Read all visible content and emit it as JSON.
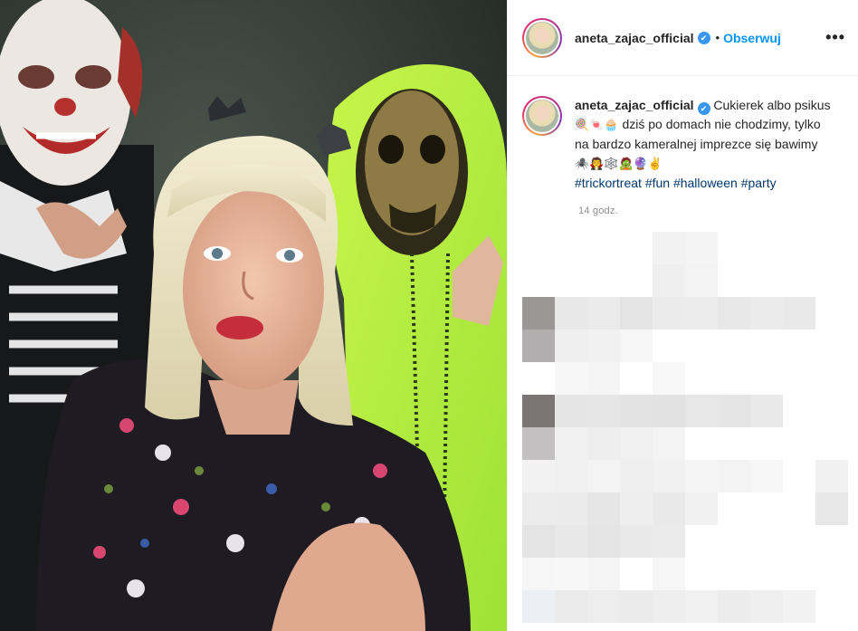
{
  "post": {
    "username": "aneta_zajac_official",
    "verified_badge": "✔",
    "dot": "•",
    "follow_label": "Obserwuj",
    "more_label": "•••",
    "caption": {
      "text_1": "Cukierek albo psikus",
      "emojis_1": "🍭🍬🧁",
      "text_2": "dziś po domach nie chodzimy, tylko na bardzo kameralnej imprezce się bawimy",
      "emojis_2": "🕷️🧛🕸️🧟🔮✌️",
      "hashtags": [
        "#trickortreat",
        "#fun",
        "#halloween",
        "#party"
      ]
    },
    "time": "14 godz."
  },
  "colors": {
    "accent": "#0095f6",
    "hashtag": "#00376b",
    "neon_green": "#b6f03c",
    "muted": "#8e8e8e"
  },
  "icons": {
    "verified": "verified-badge-icon",
    "more": "more-options-icon"
  },
  "photo": {
    "alt": "Halloween selfie"
  }
}
